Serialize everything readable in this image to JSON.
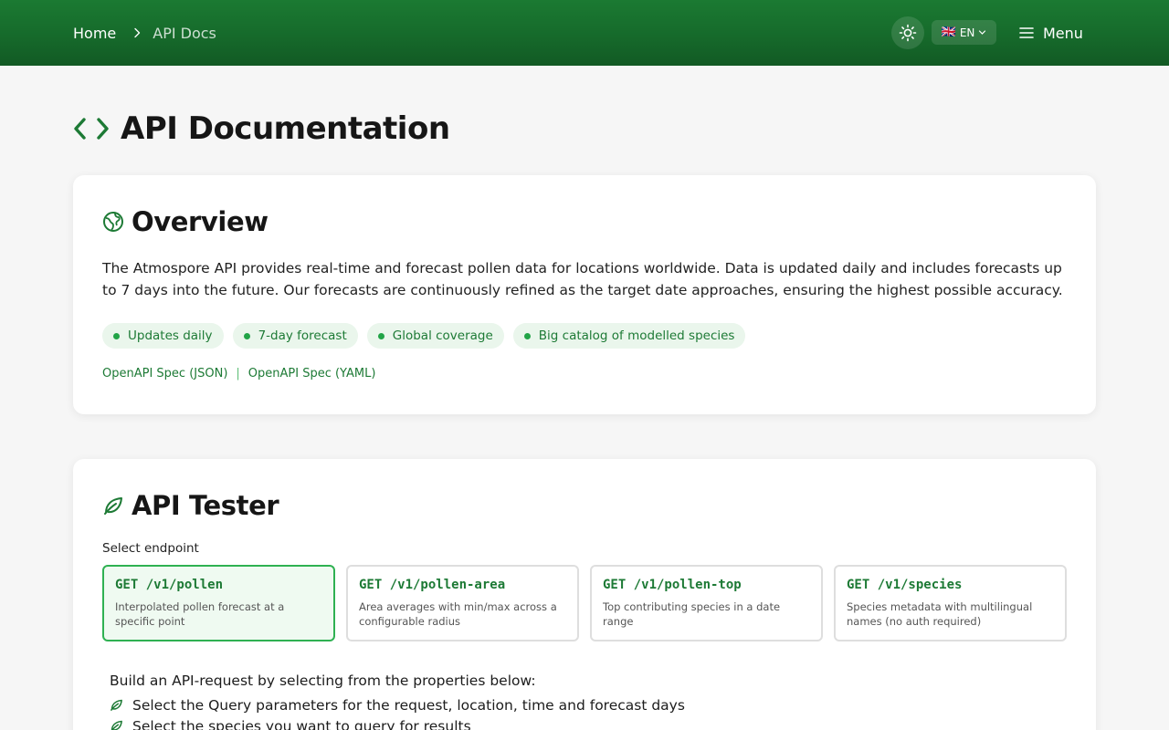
{
  "header": {
    "breadcrumb": {
      "home": "Home",
      "current": "API Docs"
    },
    "language": {
      "flag": "🇬🇧",
      "code": "EN"
    },
    "menu_label": "Menu",
    "icons": {
      "separator": "chevron-right-icon",
      "theme": "sun-icon",
      "language_caret": "chevron-down-icon",
      "menu": "hamburger-icon"
    }
  },
  "page": {
    "title": "API Documentation",
    "title_icon": "code-brackets-icon"
  },
  "overview": {
    "heading": "Overview",
    "icon": "globe-icon",
    "description": "The Atmospore API provides real-time and forecast pollen data for locations worldwide. Data is updated daily and includes forecasts up to 7 days into the future. Our forecasts are continuously refined as the target date approaches, ensuring the highest possible accuracy.",
    "tags": [
      "Updates daily",
      "7-day forecast",
      "Global coverage",
      "Big catalog of modelled species"
    ],
    "links": [
      "OpenAPI Spec (JSON)",
      "OpenAPI Spec (YAML)"
    ],
    "link_separator": "|"
  },
  "tester": {
    "heading": "API Tester",
    "icon": "leaf-icon",
    "select_label": "Select endpoint",
    "endpoints": [
      {
        "method_path": "GET /v1/pollen",
        "description": "Interpolated pollen forecast at a specific point",
        "selected": true
      },
      {
        "method_path": "GET /v1/pollen-area",
        "description": "Area averages with min/max across a configurable radius",
        "selected": false
      },
      {
        "method_path": "GET /v1/pollen-top",
        "description": "Top contributing species in a date range",
        "selected": false
      },
      {
        "method_path": "GET /v1/species",
        "description": "Species metadata with multilingual names (no auth required)",
        "selected": false
      }
    ],
    "build_intro": "Build an API-request by selecting from the properties below:",
    "build_steps": [
      "Select the Query parameters for the request, location, time and forecast days",
      "Select the species you want to query for results"
    ]
  },
  "colors": {
    "header_green": "#166a2b",
    "accent": "#1d7a35",
    "accent_bright": "#2fb152",
    "tag_bg": "#eaf6ec"
  }
}
